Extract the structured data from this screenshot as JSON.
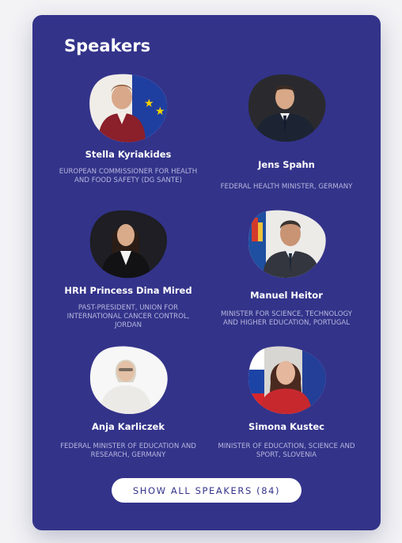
{
  "section": {
    "title": "Speakers"
  },
  "speakers": [
    {
      "name": "Stella Kyriakides",
      "role": "EUROPEAN COMMISSIONER FOR HEALTH AND FOOD SAFETY (DG SANTE)"
    },
    {
      "name": "Jens Spahn",
      "role": "FEDERAL HEALTH MINISTER, GERMANY"
    },
    {
      "name": "HRH Princess Dina Mired",
      "role": "PAST-PRESIDENT, UNION FOR INTERNATIONAL CANCER CONTROL, JORDAN"
    },
    {
      "name": "Manuel Heitor",
      "role": "MINISTER FOR SCIENCE, TECHNOLOGY AND HIGHER EDUCATION, PORTUGAL"
    },
    {
      "name": "Anja Karliczek",
      "role": "FEDERAL MINISTER OF EDUCATION AND RESEARCH, GERMANY"
    },
    {
      "name": "Simona Kustec",
      "role": "MINISTER OF EDUCATION, SCIENCE AND SPORT, SLOVENIA"
    }
  ],
  "actions": {
    "show_all_label": "SHOW ALL SPEAKERS (84)"
  },
  "colors": {
    "card_bg": "#33338a",
    "role_text": "#b7b7de",
    "button_bg": "#ffffff",
    "button_text": "#33338a"
  }
}
